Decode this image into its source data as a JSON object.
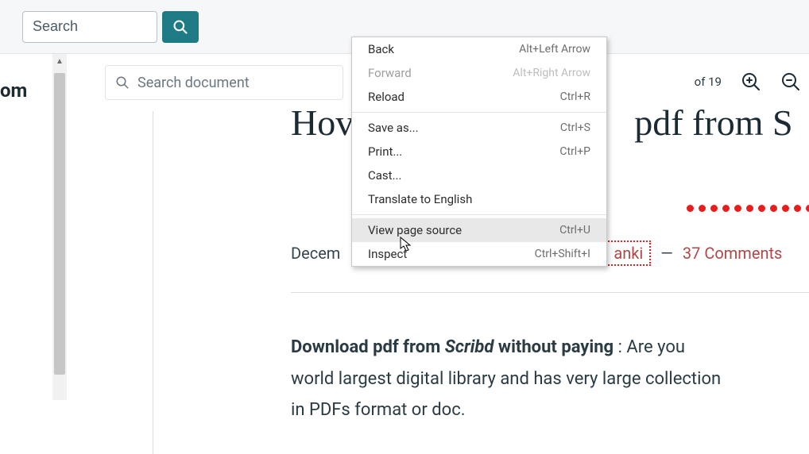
{
  "topbar": {
    "search_placeholder": "Search"
  },
  "left_fragment": "om",
  "doc_toolbar": {
    "search_placeholder": "Search document",
    "page_of": "of 19"
  },
  "article": {
    "title_left": "Hov",
    "title_right": "pdf from S",
    "date": "Decem",
    "author": "anki",
    "dash": "—",
    "comments": "37 Comments",
    "body_lead_bold": "Download pdf from ",
    "body_brand": "Scribd",
    "body_lead_bold2": " without paying",
    "body_rest1": " : Are you",
    "body_line2": "world largest digital library and has very large collection",
    "body_line3": "in PDFs format or doc."
  },
  "context_menu": {
    "items": [
      {
        "label": "Back",
        "shortcut": "Alt+Left Arrow",
        "disabled": false
      },
      {
        "label": "Forward",
        "shortcut": "Alt+Right Arrow",
        "disabled": true
      },
      {
        "label": "Reload",
        "shortcut": "Ctrl+R",
        "disabled": false
      }
    ],
    "items2": [
      {
        "label": "Save as...",
        "shortcut": "Ctrl+S",
        "disabled": false
      },
      {
        "label": "Print...",
        "shortcut": "Ctrl+P",
        "disabled": false
      },
      {
        "label": "Cast...",
        "shortcut": "",
        "disabled": false
      },
      {
        "label": "Translate to English",
        "shortcut": "",
        "disabled": false
      }
    ],
    "items3": [
      {
        "label": "View page source",
        "shortcut": "Ctrl+U",
        "disabled": false,
        "hover": true
      },
      {
        "label": "Inspect",
        "shortcut": "Ctrl+Shift+I",
        "disabled": false
      }
    ]
  }
}
